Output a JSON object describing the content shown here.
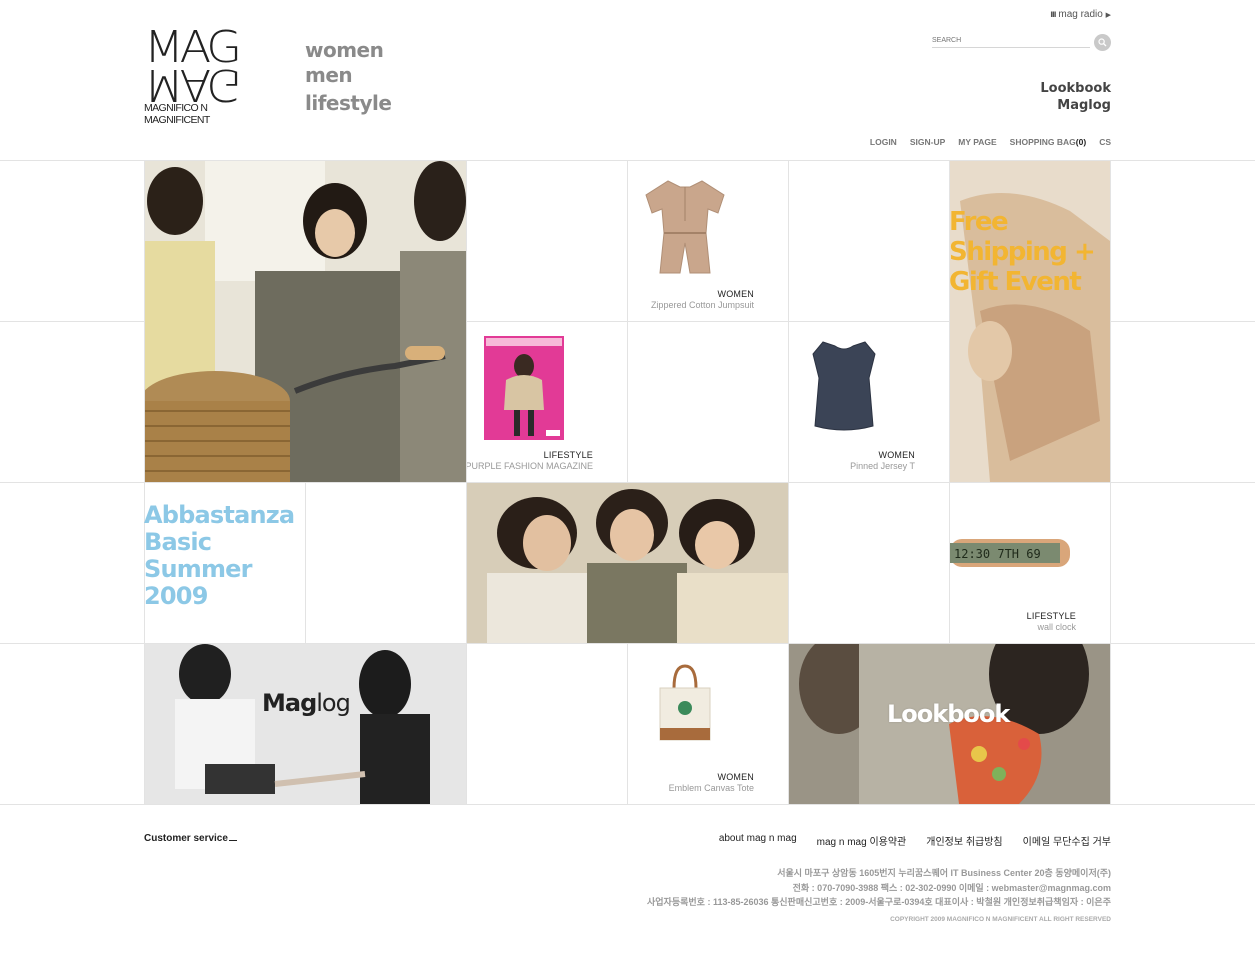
{
  "header": {
    "logo": {
      "line1": "MAG",
      "line2": "MAG",
      "sub1": "MAGNIFICO N",
      "sub2": "MAGNIFICENT"
    },
    "categories": [
      "women",
      "men",
      "lifestyle"
    ],
    "radio": {
      "label": "mag radio",
      "bars_icon": "bars-icon",
      "arrow_icon": "play-arrow-icon"
    },
    "search": {
      "placeholder": "SEARCH",
      "button_icon": "search-icon"
    },
    "quick_links": [
      "Lookbook",
      "Maglog"
    ],
    "util_nav": {
      "login": "LOGIN",
      "signup": "SIGN-UP",
      "mypage": "MY PAGE",
      "bag": "SHOPPING BAG",
      "bag_count": "(0)",
      "cs": "CS"
    }
  },
  "grid": {
    "promo_shipping": [
      "Free",
      "Shipping +",
      "Gift Event"
    ],
    "promo_summer": [
      "Abbastanza",
      "Basic",
      "Summer",
      "2009"
    ],
    "products": [
      {
        "category": "WOMEN",
        "name": "Zippered Cotton Jumpsuit"
      },
      {
        "category": "LIFESTYLE",
        "name": "PURPLE FASHION MAGAZINE"
      },
      {
        "category": "WOMEN",
        "name": "Pinned Jersey T"
      },
      {
        "category": "LIFESTYLE",
        "name": "wall clock"
      },
      {
        "category": "WOMEN",
        "name": "Emblem Canvas Tote"
      }
    ],
    "maglog": {
      "bold": "Mag",
      "light": "log"
    },
    "lookbook": "Lookbook",
    "clock_display": "12:30 7TH 69"
  },
  "footer": {
    "cs_title": "Customer service",
    "nav": [
      "about mag n mag",
      "mag n mag 이용약관",
      "개인정보 취급방침",
      "이메일 무단수집 거부"
    ],
    "info": [
      "서울시 마포구 상암동 1605번지 누리꿈스퀘어 IT Business Center 20층 동양메이저(주)",
      "전화 : 070-7090-3988 팩스 : 02-302-0990 이메일 : webmaster@magnmag.com",
      "사업자등록번호 : 113-85-26036 통신판매신고번호 : 2009-서울구로-0394호 대표이사 : 박철원 개인정보취급책임자 : 이은주"
    ],
    "copyright": "COPYRIGHT 2009 MAGNIFICO N MAGNIFICENT ALL RIGHT RESERVED"
  },
  "colors": {
    "promo_yellow": "#f2b532",
    "promo_blue": "#8cc8e6",
    "grid_line": "#e3e3e3"
  }
}
